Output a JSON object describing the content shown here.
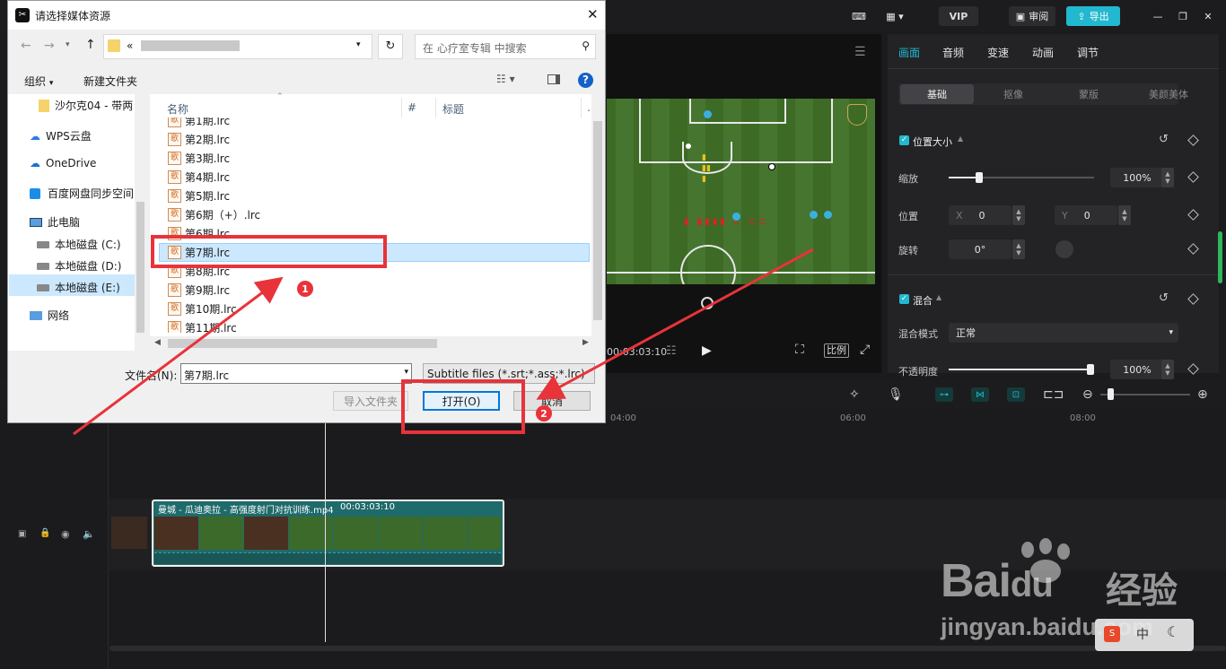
{
  "editor": {
    "vip_label": "VIP",
    "review_label": "审阅",
    "export_label": "导出",
    "timecode": "00:03:03:10",
    "ratio_label": "比例",
    "tabs": [
      "画面",
      "音频",
      "变速",
      "动画",
      "调节"
    ],
    "segments": [
      "基础",
      "抠像",
      "蒙版",
      "美颜美体"
    ],
    "position_size_label": "位置大小",
    "scale_label": "缩放",
    "scale_value": "100%",
    "scale_level": 0.1,
    "position_label": "位置",
    "x_label": "X",
    "x_value": "0",
    "y_label": "Y",
    "y_value": "0",
    "rotate_label": "旋转",
    "rotate_value": "0°",
    "blend_label": "混合",
    "blend_mode_label": "混合模式",
    "blend_mode_value": "正常",
    "opacity_label": "不透明度",
    "opacity_value": "100%",
    "opacity_level": 1.0,
    "clip_label": "曼城 - 瓜迪奥拉 - 高强度射门对抗训练.mp4",
    "clip_duration": "00:03:03:10",
    "ruler": [
      "04:00",
      "06:00",
      "08:00"
    ]
  },
  "dialog": {
    "title": "请选择媒体资源",
    "search_placeholder": "在 心疗室专辑 中搜索",
    "address_prefix": "«",
    "organize_label": "组织",
    "new_folder_label": "新建文件夹",
    "nav": [
      "沙尔克04 - 带两",
      "WPS云盘",
      "OneDrive",
      "百度网盘同步空间",
      "此电脑",
      "本地磁盘 (C:)",
      "本地磁盘 (D:)",
      "本地磁盘 (E:)",
      "网络"
    ],
    "columns": [
      "名称",
      "#",
      "标题"
    ],
    "files": [
      "第1期.lrc",
      "第2期.lrc",
      "第3期.lrc",
      "第4期.lrc",
      "第5期.lrc",
      "第6期（+）.lrc",
      "第6期.lrc",
      "第7期.lrc",
      "第8期.lrc",
      "第9期.lrc",
      "第10期.lrc",
      "第11期.lrc"
    ],
    "file_icon_char": "歌",
    "filename_label": "文件名(N):",
    "filename_value": "第7期.lrc",
    "filter_value": "Subtitle files (*.srt;*.ass;*.lrc)",
    "import_folder_label": "导入文件夹",
    "open_label": "打开(O)",
    "cancel_label": "取消"
  },
  "annotations": {
    "badge1": "1",
    "badge2": "2",
    "highlight_color": "#e8333a"
  },
  "watermark": {
    "brand": "Bai",
    "brand2": "du",
    "brand_cn": "经验",
    "url": "jingyan.baidu.com"
  },
  "corner": {
    "lang": "中"
  }
}
